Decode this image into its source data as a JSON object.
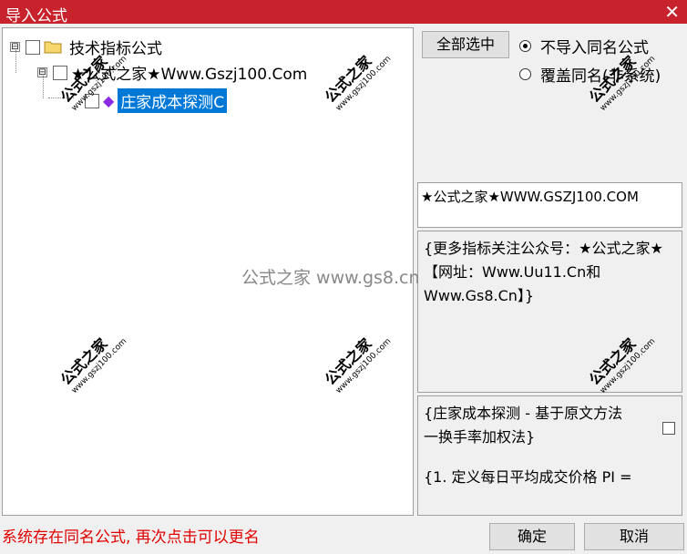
{
  "window": {
    "title": "导入公式",
    "close_glyph": "✕"
  },
  "tree": {
    "root": {
      "label": "技术指标公式",
      "expander": "⊟"
    },
    "group": {
      "label": "★公式之家★Www.Gszj100.Com",
      "expander": "⊟"
    },
    "item": {
      "label": "庄家成本探测C"
    }
  },
  "actions": {
    "select_all": "全部选中",
    "radio_skip_same": "不导入同名公式",
    "radio_overwrite": "覆盖同名(非系统)"
  },
  "copyright": "★公式之家★WWW.GSZJ100.COM",
  "description": "{更多指标关注公众号：★公式之家★【网址：Www.Uu11.Cn和Www.Gs8.Cn】}",
  "detail": {
    "line1": "{庄家成本探测 - 基于原文方法",
    "line2": "一换手率加权法}",
    "line3": "{1. 定义每日平均成交价格 PI ="
  },
  "status": "系统存在同名公式, 再次点击可以更名",
  "buttons": {
    "ok": "确定",
    "cancel": "取消"
  },
  "watermark": {
    "text": "公式之家",
    "url": "www.gszj100.com",
    "center": "公式之家 www.gs8.cn"
  }
}
